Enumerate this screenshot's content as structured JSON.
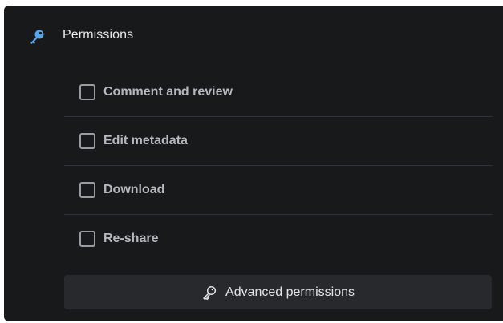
{
  "permissions": {
    "title": "Permissions",
    "header_icon": "key-icon",
    "accent_color": "#5ba4e6",
    "options": [
      {
        "label": "Comment and review",
        "checked": false
      },
      {
        "label": "Edit metadata",
        "checked": false
      },
      {
        "label": "Download",
        "checked": false
      },
      {
        "label": "Re-share",
        "checked": false
      }
    ],
    "advanced_button": {
      "label": "Advanced permissions",
      "icon": "key-outline-icon"
    }
  }
}
